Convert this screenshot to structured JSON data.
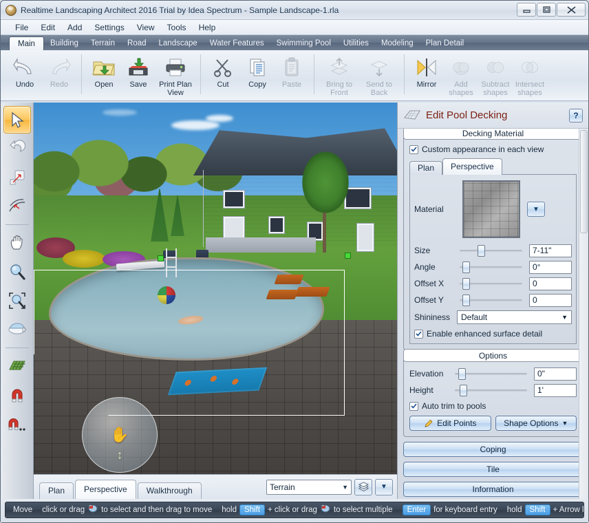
{
  "window": {
    "title": "Realtime Landscaping Architect 2016 Trial by Idea Spectrum - Sample Landscape-1.rla",
    "app_icon": "app-logo-icon",
    "buttons": {
      "minimize": "minimize-icon",
      "maximize": "maximize-icon",
      "close": "close-icon"
    }
  },
  "menubar": {
    "items": [
      "File",
      "Edit",
      "Add",
      "Settings",
      "View",
      "Tools",
      "Help"
    ]
  },
  "ribbon": {
    "tabs": [
      "Main",
      "Building",
      "Terrain",
      "Road",
      "Landscape",
      "Water Features",
      "Swimming Pool",
      "Utilities",
      "Modeling",
      "Plan Detail"
    ],
    "active_tab": "Main",
    "groups": [
      {
        "buttons": [
          {
            "label": "Undo",
            "icon": "undo-arrow-icon",
            "enabled": true
          },
          {
            "label": "Redo",
            "icon": "redo-arrow-icon",
            "enabled": false
          }
        ]
      },
      {
        "buttons": [
          {
            "label": "Open",
            "icon": "open-folder-icon",
            "enabled": true
          },
          {
            "label": "Save",
            "icon": "floppy-disk-icon",
            "enabled": true
          },
          {
            "label": "Print Plan View",
            "icon": "printer-icon",
            "enabled": true
          }
        ]
      },
      {
        "buttons": [
          {
            "label": "Cut",
            "icon": "scissors-icon",
            "enabled": true
          },
          {
            "label": "Copy",
            "icon": "copy-pages-icon",
            "enabled": true
          },
          {
            "label": "Paste",
            "icon": "clipboard-icon",
            "enabled": false
          }
        ]
      },
      {
        "buttons": [
          {
            "label": "Bring to Front",
            "icon": "bring-to-front-icon",
            "enabled": false
          },
          {
            "label": "Send to Back",
            "icon": "send-to-back-icon",
            "enabled": false
          }
        ]
      },
      {
        "buttons": [
          {
            "label": "Mirror",
            "icon": "mirror-icon",
            "enabled": true
          },
          {
            "label": "Add shapes",
            "icon": "union-shapes-icon",
            "enabled": false
          },
          {
            "label": "Subtract shapes",
            "icon": "subtract-shapes-icon",
            "enabled": false
          },
          {
            "label": "Intersect shapes",
            "icon": "intersect-shapes-icon",
            "enabled": false
          }
        ]
      }
    ]
  },
  "toolrail": {
    "tools": [
      {
        "name": "select-arrow-tool",
        "selected": true
      },
      {
        "name": "rotate-tool",
        "selected": false
      },
      {
        "name": "resize-tool",
        "selected": false
      },
      {
        "name": "curve-edit-tool",
        "selected": false
      },
      {
        "name": "pan-hand-tool",
        "selected": false
      },
      {
        "name": "zoom-tool",
        "selected": false
      },
      {
        "name": "zoom-window-tool",
        "selected": false
      },
      {
        "name": "orbit-tool",
        "selected": false
      },
      {
        "name": "grid-tool",
        "selected": false
      },
      {
        "name": "snap-magnet-tool",
        "selected": false
      },
      {
        "name": "snap-options-tool",
        "selected": false
      }
    ]
  },
  "viewport": {
    "view_tabs": [
      "Plan",
      "Perspective",
      "Walkthrough"
    ],
    "active_view_tab": "Perspective",
    "layer_select": {
      "value": "Terrain",
      "options": [
        "Terrain"
      ]
    },
    "layers_button": "layers-icon",
    "layers_dropdown": "chevron-down-icon"
  },
  "panel": {
    "icon": "pool-decking-icon",
    "title": "Edit Pool Decking",
    "help": "?",
    "title_color": "#7a1f12",
    "material_group": {
      "title": "Decking Material",
      "custom_appearance": {
        "label": "Custom appearance in each view",
        "checked": true
      },
      "tabs": [
        "Plan",
        "Perspective"
      ],
      "active_tab": "Perspective",
      "material": {
        "label": "Material",
        "swatch": "stone-paver-texture",
        "dropdown": "chevron-down-icon"
      },
      "sliders": [
        {
          "label": "Size",
          "value": "7-11\"",
          "pos": 30
        },
        {
          "label": "Angle",
          "value": "0°",
          "pos": 8
        },
        {
          "label": "Offset X",
          "value": "0",
          "pos": 8
        },
        {
          "label": "Offset Y",
          "value": "0",
          "pos": 8
        }
      ],
      "shininess": {
        "label": "Shininess",
        "value": "Default"
      },
      "enhanced_detail": {
        "label": "Enable enhanced surface detail",
        "checked": true
      }
    },
    "options_group": {
      "title": "Options",
      "sliders": [
        {
          "label": "Elevation",
          "value": "0\"",
          "pos": 8
        },
        {
          "label": "Height",
          "value": "1'",
          "pos": 10
        }
      ],
      "auto_trim": {
        "label": "Auto trim to pools",
        "checked": true
      },
      "edit_points_button": {
        "label": "Edit Points",
        "icon": "pencil-icon"
      },
      "shape_options_button": {
        "label": "Shape Options",
        "icon": "chevron-down-icon"
      }
    },
    "wide_buttons": [
      "Coping",
      "Tile",
      "Information"
    ]
  },
  "statusbar": {
    "segments": [
      {
        "type": "text",
        "text": "Move"
      },
      {
        "type": "divider"
      },
      {
        "type": "text",
        "text": "click or drag"
      },
      {
        "type": "mouse",
        "icon": "mouse-left-click-icon"
      },
      {
        "type": "text",
        "text": "to select and then drag to move"
      },
      {
        "type": "divider"
      },
      {
        "type": "text",
        "text": "hold"
      },
      {
        "type": "key",
        "text": "Shift"
      },
      {
        "type": "text",
        "text": "+ click or drag"
      },
      {
        "type": "mouse",
        "icon": "mouse-left-click-icon"
      },
      {
        "type": "text",
        "text": "to select multiple"
      },
      {
        "type": "divider"
      },
      {
        "type": "key",
        "text": "Enter"
      },
      {
        "type": "text",
        "text": "for keyboard entry"
      },
      {
        "type": "divider"
      },
      {
        "type": "text",
        "text": "hold"
      },
      {
        "type": "key",
        "text": "Shift"
      },
      {
        "type": "text",
        "text": "+ Arrow key to nudge"
      },
      {
        "type": "divider"
      }
    ]
  }
}
